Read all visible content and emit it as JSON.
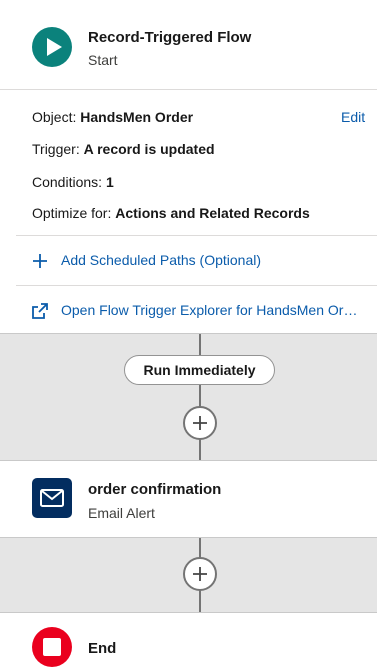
{
  "start": {
    "title": "Record-Triggered Flow",
    "subtitle": "Start",
    "object_label": "Object:",
    "object_value": "HandsMen Order",
    "edit_label": "Edit",
    "trigger_label": "Trigger:",
    "trigger_value": "A record is updated",
    "conditions_label": "Conditions:",
    "conditions_value": "1",
    "optimize_label": "Optimize for:",
    "optimize_value": "Actions and Related Records",
    "add_paths_label": "Add Scheduled Paths (Optional)",
    "explorer_label": "Open Flow Trigger Explorer for HandsMen Order"
  },
  "path": {
    "run_label": "Run Immediately"
  },
  "email_alert": {
    "title": "order confirmation",
    "subtitle": "Email Alert"
  },
  "end": {
    "label": "End"
  },
  "colors": {
    "start_icon": "#0b827c",
    "email_icon": "#032d60",
    "end_icon": "#ea001e",
    "link": "#0b5cab",
    "canvas": "#e5e5e5"
  },
  "icons": {
    "start": "play-icon",
    "email": "envelope-icon",
    "end": "stop-icon",
    "add": "plus-icon",
    "external": "external-link-icon"
  }
}
